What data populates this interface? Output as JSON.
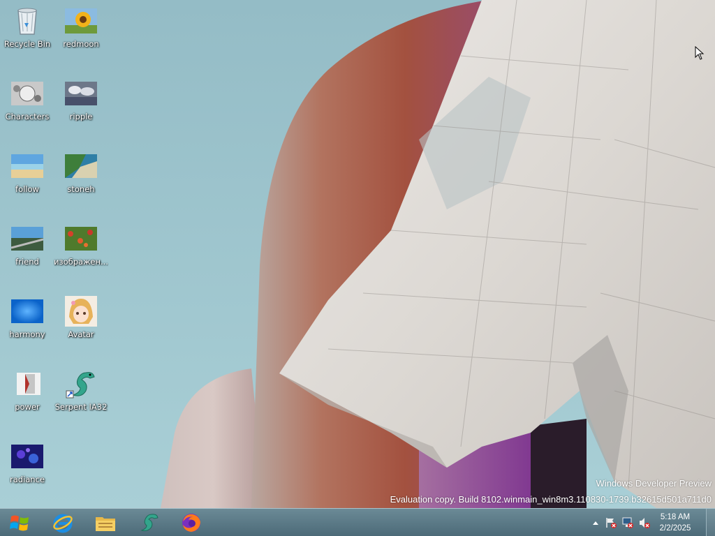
{
  "desktop": {
    "icons": [
      {
        "label": "Recycle Bin",
        "icon": "recycle-bin-icon"
      },
      {
        "label": "redmoon",
        "icon": "sunflower-image-icon"
      },
      {
        "label": "Characters",
        "icon": "characters-image-icon"
      },
      {
        "label": "ripple",
        "icon": "ripple-image-icon"
      },
      {
        "label": "follow",
        "icon": "beach-image-icon"
      },
      {
        "label": "stoneh",
        "icon": "coast-image-icon"
      },
      {
        "label": "friend",
        "icon": "railway-image-icon"
      },
      {
        "label": "изображен...",
        "icon": "flowers-image-icon"
      },
      {
        "label": "harmony",
        "icon": "blue-abstract-image-icon"
      },
      {
        "label": "Avatar",
        "icon": "anime-avatar-image-icon"
      },
      {
        "label": "power",
        "icon": "power-image-icon"
      },
      {
        "label": "Serpent IA32",
        "icon": "serpent-shortcut-icon"
      },
      {
        "label": "radiance",
        "icon": "radiance-image-icon"
      }
    ]
  },
  "watermark": {
    "line1": "Windows Developer Preview",
    "line2": "Evaluation copy. Build 8102.winmain_win8m3.110830-1739.b32615d501a711d0"
  },
  "taskbar": {
    "pinned": [
      {
        "name": "internet-explorer-icon"
      },
      {
        "name": "file-explorer-icon"
      },
      {
        "name": "serpent-icon"
      },
      {
        "name": "firefox-icon"
      }
    ],
    "clock": {
      "time": "5:18 AM",
      "date": "2/2/2025"
    }
  }
}
